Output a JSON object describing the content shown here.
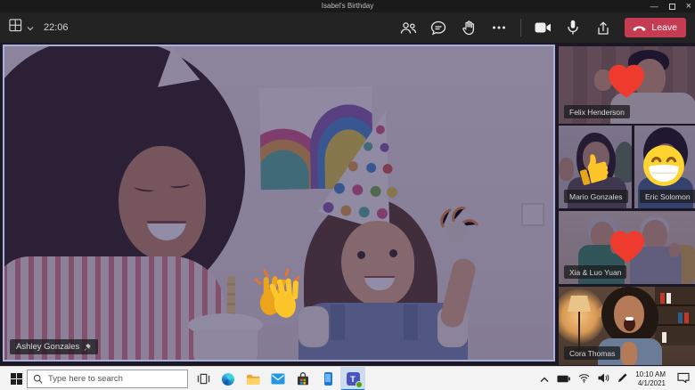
{
  "window": {
    "title": "Isabel's Birthday",
    "controls": {
      "minimize": "minimize",
      "maximize": "maximize",
      "close": "close"
    }
  },
  "toolbar": {
    "view_icon": "grid-view-icon",
    "timer": "22:06",
    "icons": [
      "participants-icon",
      "chat-icon",
      "raise-hand-icon",
      "more-icon",
      "camera-icon",
      "mic-icon",
      "share-screen-icon"
    ],
    "leave_label": "Leave"
  },
  "stage": {
    "main": {
      "name": "Ashley Gonzales",
      "pinned": true,
      "reaction": "clapping-hands"
    },
    "participants": [
      {
        "name": "Felix Henderson",
        "reaction": "heart"
      },
      {
        "name": "Mario Gonzales",
        "reaction": "thumbs-up"
      },
      {
        "name": "Eric Solomon",
        "reaction": "grinning-face"
      },
      {
        "name": "Xia & Luo Yuan",
        "reaction": "heart"
      },
      {
        "name": "Cora Thomas",
        "reaction": ""
      }
    ]
  },
  "taskbar": {
    "search_placeholder": "Type here to search",
    "apps": [
      "start",
      "task-view",
      "edge",
      "file-explorer",
      "mail",
      "store",
      "your-phone",
      "teams"
    ],
    "teams_label": "T",
    "tray": {
      "icons": [
        "chevron-up",
        "battery",
        "wifi",
        "volume",
        "pen",
        "action-center"
      ],
      "time": "10:10 AM",
      "date": "4/1/2021"
    }
  },
  "colors": {
    "leave_red": "#c43b52",
    "video_border": "#a9b0dc",
    "taskbar_accent": "#0078d7",
    "teams_purple": "#4b53bc",
    "reaction_red": "#ee3b2e",
    "reaction_yellow": "#fcc62a"
  }
}
